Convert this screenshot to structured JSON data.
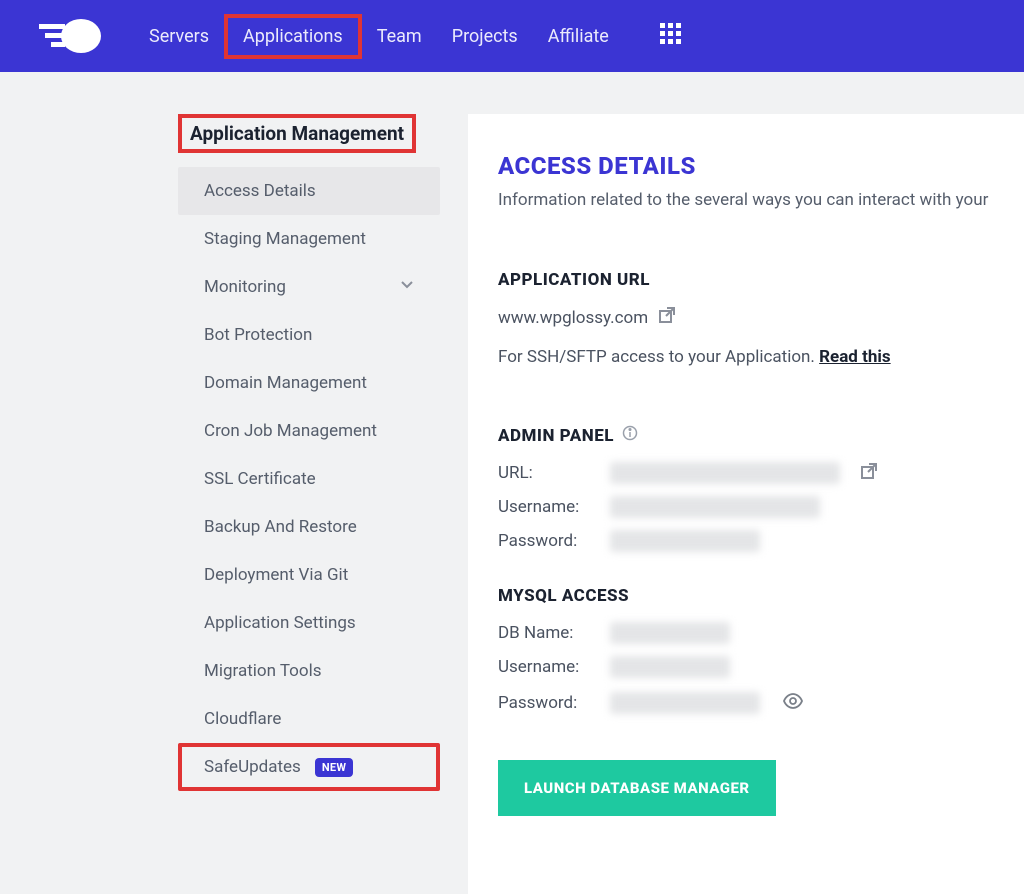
{
  "topnav": {
    "items": [
      {
        "label": "Servers",
        "active": false
      },
      {
        "label": "Applications",
        "active": true
      },
      {
        "label": "Team",
        "active": false
      },
      {
        "label": "Projects",
        "active": false
      },
      {
        "label": "Affiliate",
        "active": false
      }
    ]
  },
  "sidebar": {
    "title": "Application Management",
    "items": [
      {
        "label": "Access Details",
        "active": true,
        "chevron": false
      },
      {
        "label": "Staging Management",
        "active": false,
        "chevron": false
      },
      {
        "label": "Monitoring",
        "active": false,
        "chevron": true
      },
      {
        "label": "Bot Protection",
        "active": false,
        "chevron": false
      },
      {
        "label": "Domain Management",
        "active": false,
        "chevron": false
      },
      {
        "label": "Cron Job Management",
        "active": false,
        "chevron": false
      },
      {
        "label": "SSL Certificate",
        "active": false,
        "chevron": false
      },
      {
        "label": "Backup And Restore",
        "active": false,
        "chevron": false
      },
      {
        "label": "Deployment Via Git",
        "active": false,
        "chevron": false
      },
      {
        "label": "Application Settings",
        "active": false,
        "chevron": false
      },
      {
        "label": "Migration Tools",
        "active": false,
        "chevron": false
      },
      {
        "label": "Cloudflare",
        "active": false,
        "chevron": false
      },
      {
        "label": "SafeUpdates",
        "active": false,
        "chevron": false,
        "badge": "NEW",
        "highlighted": true
      }
    ]
  },
  "panel": {
    "title": "ACCESS DETAILS",
    "subtitle": "Information related to the several ways you can interact with your",
    "app_url_label": "APPLICATION URL",
    "app_url": "www.wpglossy.com",
    "ssh_hint_pre": "For SSH/SFTP access to your Application. ",
    "ssh_hint_link": "Read this",
    "admin_label": "ADMIN PANEL",
    "admin_url_label": "URL:",
    "admin_user_label": "Username:",
    "admin_pass_label": "Password:",
    "mysql_label": "MYSQL ACCESS",
    "mysql_db_label": "DB Name:",
    "mysql_user_label": "Username:",
    "mysql_pass_label": "Password:",
    "launch_db_btn": "LAUNCH DATABASE MANAGER"
  }
}
